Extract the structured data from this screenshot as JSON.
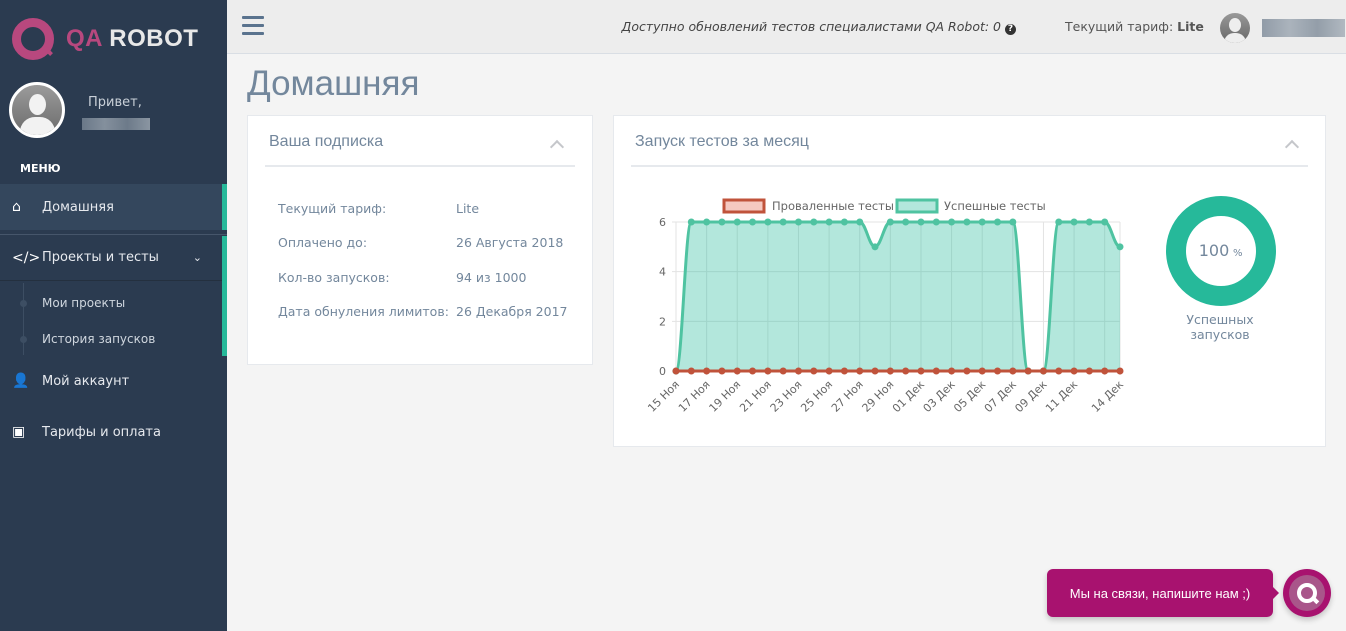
{
  "brand": {
    "qa": "QA",
    "robot": "ROBOT"
  },
  "sidebar": {
    "greeting": "Привет,",
    "menu_heading": "МЕНЮ",
    "items": [
      {
        "label": "Домашняя",
        "icon": "home-icon"
      },
      {
        "label": "Проекты и тесты",
        "icon": "code-icon",
        "children": [
          {
            "label": "Мои проекты"
          },
          {
            "label": "История запусков"
          }
        ]
      },
      {
        "label": "Мой аккаунт",
        "icon": "user-icon"
      },
      {
        "label": "Тарифы и оплата",
        "icon": "money-icon"
      }
    ]
  },
  "header": {
    "updates_text": "Доступно обновлений тестов специалистами QA Robot: 0",
    "tariff_label": "Текущий тариф:",
    "tariff_value": "Lite"
  },
  "page": {
    "title": "Домашняя"
  },
  "subscription": {
    "title": "Ваша подписка",
    "rows": [
      {
        "label": "Текущий тариф:",
        "value": "Lite"
      },
      {
        "label": "Оплачено до:",
        "value": "26 Августа 2018"
      },
      {
        "label": "Кол-во запусков:",
        "value": "94 из 1000"
      },
      {
        "label": "Дата обнуления лимитов:",
        "value": "26 Декабря 2017"
      }
    ]
  },
  "runs": {
    "title": "Запуск тестов за месяц",
    "donut_value": "100",
    "donut_unit": "%",
    "donut_label": "Успешных запусков",
    "donut_fraction": 1.0
  },
  "chart_data": {
    "type": "line",
    "x": [
      "15 Ноя",
      "16 Ноя",
      "17 Ноя",
      "18 Ноя",
      "19 Ноя",
      "20 Ноя",
      "21 Ноя",
      "22 Ноя",
      "23 Ноя",
      "24 Ноя",
      "25 Ноя",
      "26 Ноя",
      "27 Ноя",
      "28 Ноя",
      "29 Ноя",
      "30 Ноя",
      "01 Дек",
      "02 Дек",
      "03 Дек",
      "04 Дек",
      "05 Дек",
      "06 Дек",
      "07 Дек",
      "08 Дек",
      "09 Дек",
      "10 Дек",
      "11 Дек",
      "12 Дек",
      "13 Дек",
      "14 Дек"
    ],
    "tick_labels": [
      "15 Ноя",
      "17 Ноя",
      "19 Ноя",
      "21 Ноя",
      "23 Ноя",
      "25 Ноя",
      "27 Ноя",
      "29 Ноя",
      "01 Дек",
      "03 Дек",
      "05 Дек",
      "07 Дек",
      "09 Дек",
      "11 Дек",
      "14 Дек"
    ],
    "series": [
      {
        "name": "Проваленные тесты",
        "color": "#c0533b",
        "values": [
          0,
          0,
          0,
          0,
          0,
          0,
          0,
          0,
          0,
          0,
          0,
          0,
          0,
          0,
          0,
          0,
          0,
          0,
          0,
          0,
          0,
          0,
          0,
          0,
          0,
          0,
          0,
          0,
          0,
          0
        ]
      },
      {
        "name": "Успешные тесты",
        "color": "#4fc3a1",
        "values": [
          0,
          6,
          6,
          6,
          6,
          6,
          6,
          6,
          6,
          6,
          6,
          6,
          6,
          5,
          6,
          6,
          6,
          6,
          6,
          6,
          6,
          6,
          6,
          0,
          0,
          6,
          6,
          6,
          6,
          5
        ]
      }
    ],
    "yticks": [
      0,
      2,
      4,
      6
    ],
    "ylim": [
      0,
      6
    ],
    "legend": "top"
  },
  "chat": {
    "label": "Мы на связи, напишите нам ;)"
  }
}
